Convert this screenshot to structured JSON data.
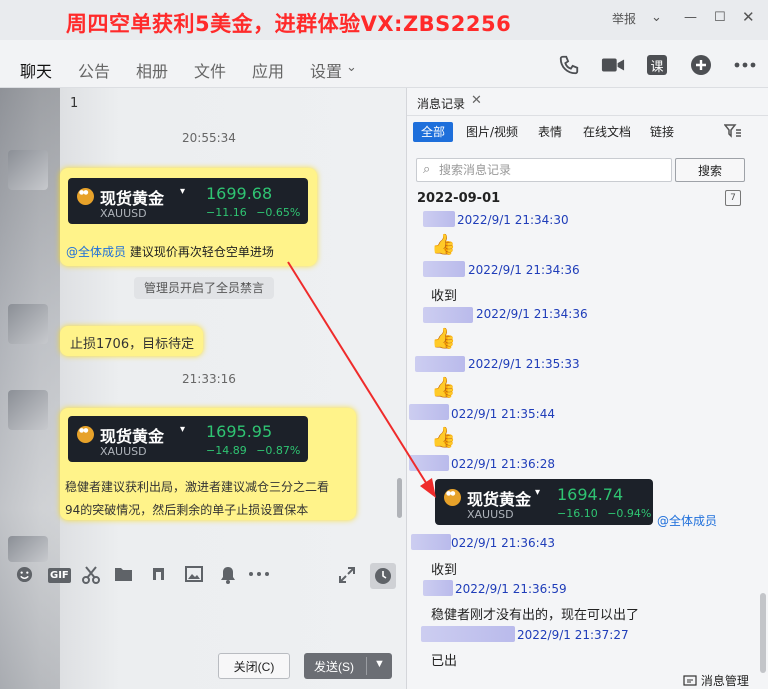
{
  "titlebar": {
    "watermark": "周四空单获利5美金，进群体验VX:ZBS2256",
    "report": "举报",
    "chevron": "⌄",
    "minimize": "—",
    "maximize": "☐",
    "close": "✕"
  },
  "nav": {
    "tabs": [
      "聊天",
      "公告",
      "相册",
      "文件",
      "应用",
      "设置"
    ],
    "settings_arrow": "⌄",
    "tools": [
      "phone-icon",
      "video-icon",
      "lesson-icon",
      "add-icon",
      "more-icon"
    ],
    "lesson_label": "课"
  },
  "chat": {
    "line1": "1",
    "time1": "20:55:34",
    "card1": {
      "name": "现货黄金",
      "symbol": "XAUUSD",
      "price": "1699.68",
      "change": "−11.16 −0.65%"
    },
    "msg1_mention": "@全体成员",
    "msg1_text": "建议现价再次轻仓空单进场",
    "system": "管理员开启了全员禁言",
    "msg2": "止损1706，目标待定",
    "time2": "21:33:16",
    "card2": {
      "name": "现货黄金",
      "symbol": "XAUUSD",
      "price": "1695.95",
      "change": "−14.89 −0.87%"
    },
    "msg3_line1": "稳健者建议获利出局，激进者建议减仓三分之二看",
    "msg3_line2": "94的突破情况，然后剩余的单子止损设置保本"
  },
  "input": {
    "tools": [
      "emoji-icon",
      "gif-icon",
      "scissors-icon",
      "folder-icon",
      "music-icon",
      "image-icon",
      "bell-icon",
      "more-icon"
    ],
    "gif_label": "GIF",
    "close_label": "关闭(C)",
    "send_label": "发送(S)"
  },
  "history": {
    "title": "消息记录",
    "close": "✕",
    "filters": [
      "全部",
      "图片/视频",
      "表情",
      "在线文档",
      "链接"
    ],
    "search_placeholder": "搜索消息记录",
    "search_button": "搜索",
    "date": "2022-09-01",
    "calendar_label": "7",
    "entries": [
      {
        "time": "2022/9/1 21:34:30",
        "text": ""
      },
      {
        "time": "2022/9/1 21:34:36",
        "text": "收到"
      },
      {
        "time": "2022/9/1 21:34:36",
        "text": ""
      },
      {
        "time": "2022/9/1 21:35:33",
        "text": ""
      },
      {
        "time": "022/9/1 21:35:44",
        "text": ""
      },
      {
        "time": "022/9/1 21:36:28",
        "text": ""
      },
      {
        "time": "022/9/1 21:36:43",
        "text": "收到"
      },
      {
        "time": "2022/9/1 21:36:59",
        "text": "稳健者刚才没有出的，现在可以出了"
      },
      {
        "time": "2022/9/1 21:37:27",
        "text": "已出"
      }
    ],
    "card": {
      "name": "现货黄金",
      "symbol": "XAUUSD",
      "price": "1694.74",
      "change": "−16.10 −0.94%"
    },
    "card_mention": "@全体成员",
    "manage": "消息管理"
  },
  "colors": {
    "accent": "#1e6fdb",
    "watermark": "#ff2a2a",
    "bubble": "#fff38a",
    "up_green": "#2fc472",
    "annotation": "#ef2b2b"
  }
}
